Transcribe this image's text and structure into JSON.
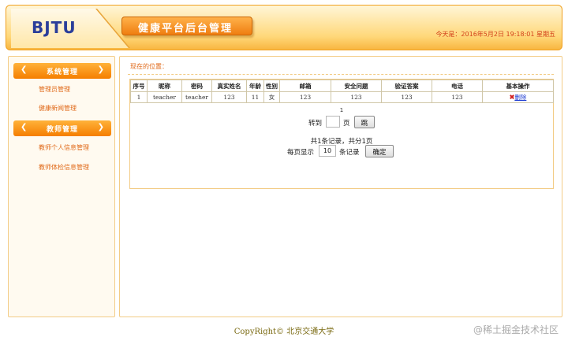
{
  "header": {
    "logo": "BJTU",
    "title": "健康平台后台管理",
    "date": "今天是：2016年5月2日  19:18:01  星期五"
  },
  "sidebar": {
    "groups": [
      {
        "label": "系统管理",
        "items": [
          "管理员管理",
          "健康新闻管理"
        ]
      },
      {
        "label": "教师管理",
        "items": [
          "教师个人信息管理",
          "教师体检信息管理"
        ]
      }
    ]
  },
  "main": {
    "location": "现在的位置：",
    "table": {
      "headers": [
        "序号",
        "昵称",
        "密码",
        "真实姓名",
        "年龄",
        "性别",
        "邮箱",
        "安全问题",
        "验证答案",
        "电话",
        "基本操作"
      ],
      "rows": [
        [
          "1",
          "teacher",
          "teacher",
          "123",
          "11",
          "女",
          "123",
          "123",
          "123",
          "123"
        ]
      ],
      "delete_label": "删除"
    },
    "pager": {
      "page_number": "1",
      "goto_label": "转到",
      "page_unit": "页",
      "jump_button": "跳",
      "summary": "共1条记录，共分1页",
      "per_page_label": "每页显示",
      "per_page_value": "10",
      "records_unit": "条记录",
      "confirm_button": "确定"
    }
  },
  "footer": {
    "copyright": "CopyRight© 北京交通大学"
  },
  "watermark": "@稀土掘金技术社区",
  "colors": {
    "accent": "#f57e00",
    "link": "#e06a1a",
    "border": "#f3cc86"
  }
}
